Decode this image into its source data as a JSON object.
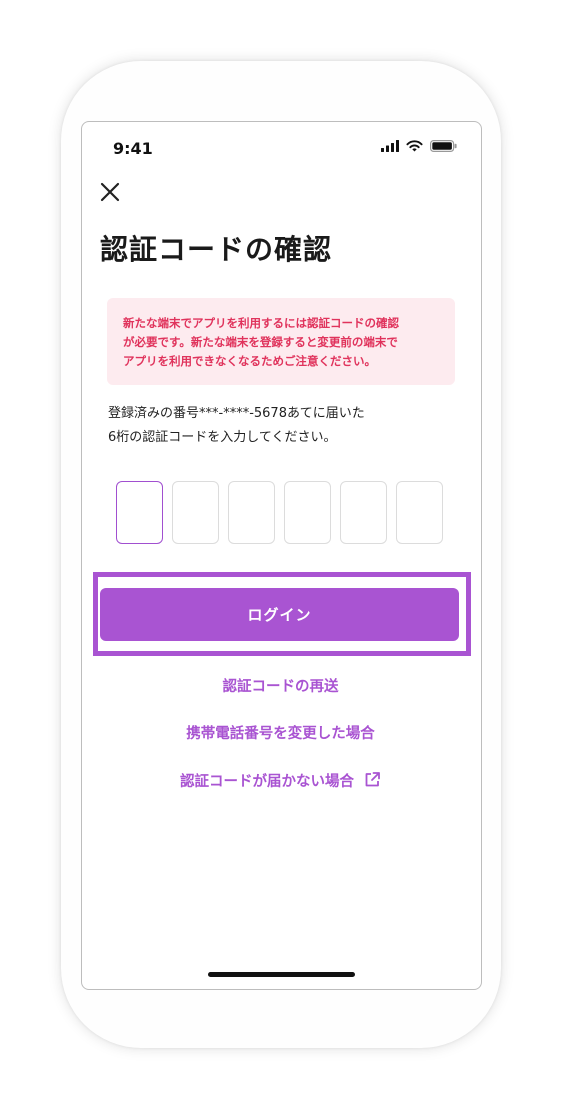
{
  "status_bar": {
    "time": "9:41"
  },
  "header": {
    "title": "認証コードの確認"
  },
  "warning": {
    "lines": [
      "新たな端末でアプリを利用するには認証コードの確認",
      "が必要です。新たな端末を登録すると変更前の端末で",
      "アプリを利用できなくなるためご注意ください。"
    ]
  },
  "instruction": {
    "lines": [
      "登録済みの番号***-****-5678あてに届いた",
      "6桁の認証コードを入力してください。"
    ]
  },
  "code_inputs": {
    "values": [
      "",
      "",
      "",
      "",
      "",
      ""
    ]
  },
  "login_button": {
    "label": "ログイン"
  },
  "links": {
    "resend": "認証コードの再送",
    "changed_number": "携帯電話番号を変更した場合",
    "not_received": "認証コードが届かない場合"
  },
  "colors": {
    "accent": "#a954d2",
    "warning_bg": "#fdebef",
    "warning_text": "#e0335c"
  },
  "icons": {
    "close": "close-icon",
    "external": "external-link-icon",
    "signal": "signal-icon",
    "wifi": "wifi-icon",
    "battery": "battery-icon"
  }
}
